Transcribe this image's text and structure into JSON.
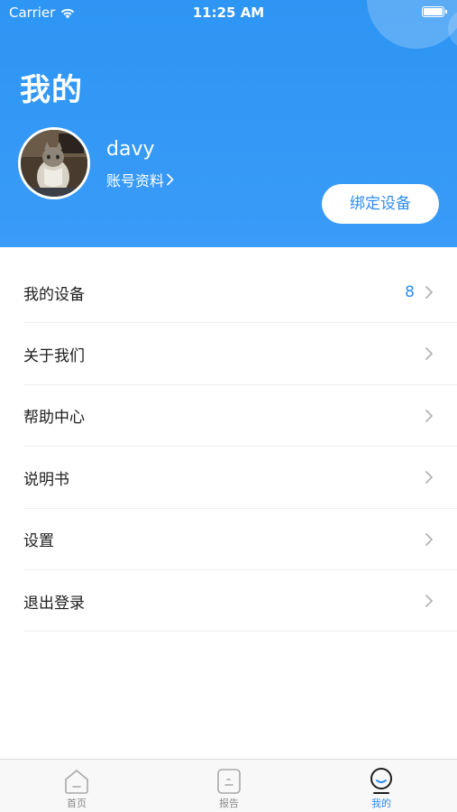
{
  "status_bar": {
    "carrier": "Carrier",
    "time": "11:25 AM"
  },
  "header": {
    "title": "我的",
    "username": "davy",
    "profile_link": "账号资料",
    "bind_button": "绑定设备"
  },
  "menu": {
    "items": [
      {
        "label": "我的设备",
        "count": "8"
      },
      {
        "label": "关于我们"
      },
      {
        "label": "帮助中心"
      },
      {
        "label": "说明书"
      },
      {
        "label": "设置"
      },
      {
        "label": "退出登录"
      }
    ]
  },
  "tabs": [
    {
      "label": "首页",
      "icon": "home-icon"
    },
    {
      "label": "报告",
      "icon": "report-icon"
    },
    {
      "label": "我的",
      "icon": "profile-icon",
      "active": true
    }
  ],
  "colors": {
    "accent": "#2d8ef0",
    "header_bg": "#3399f6"
  }
}
